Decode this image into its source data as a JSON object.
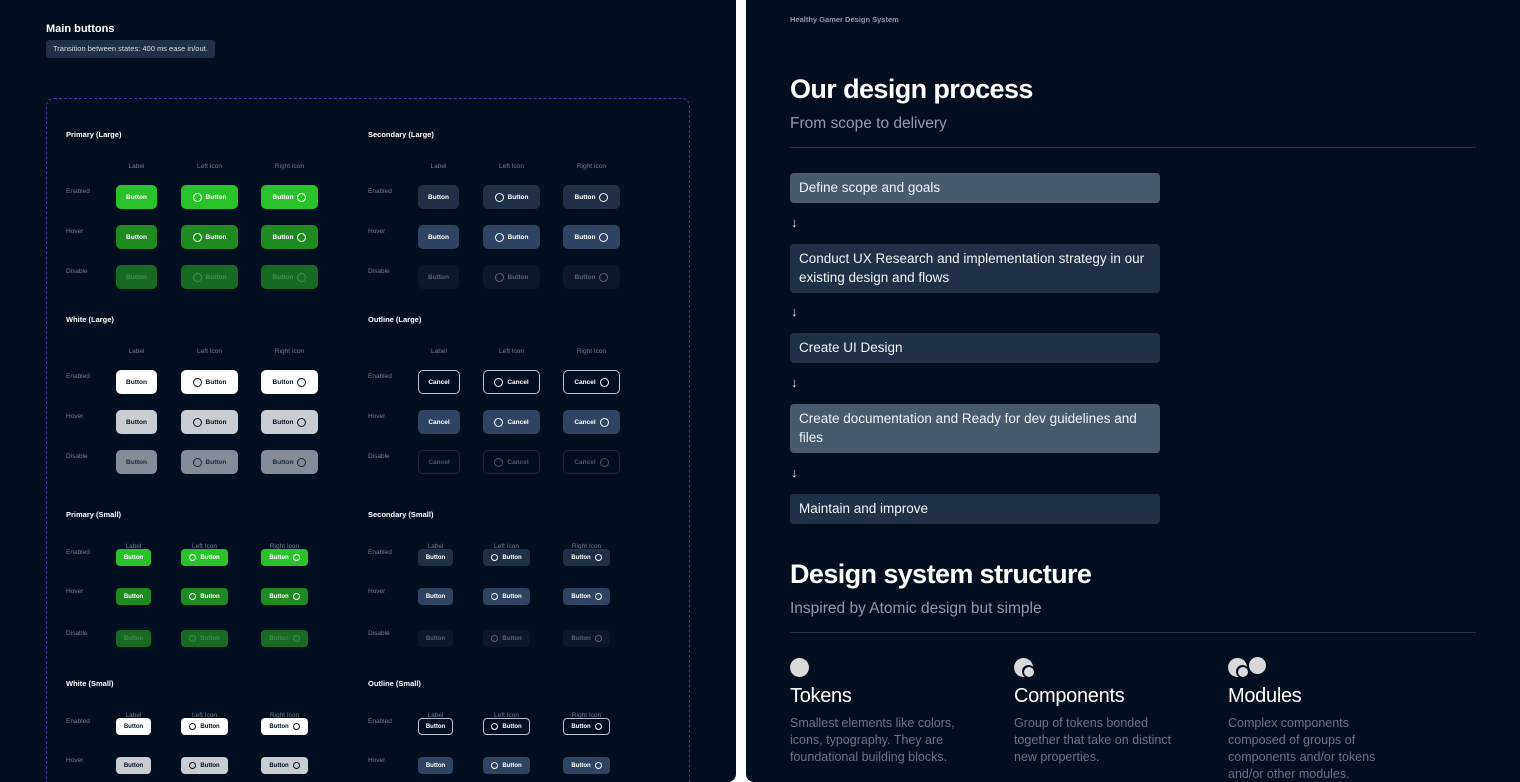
{
  "left": {
    "title": "Main buttons",
    "note": "Transition between states: 400 ms ease in/out.",
    "col_headers": [
      "Label",
      "Left Icon",
      "Right Icon"
    ],
    "row_labels": [
      "Enabled",
      "Hover",
      "Disable"
    ],
    "groups": [
      {
        "name": "primary-large",
        "title": "Primary (Large)",
        "variant": "primary",
        "size": "lg",
        "text": "Button"
      },
      {
        "name": "secondary-large",
        "title": "Secondary (Large)",
        "variant": "secondary",
        "size": "lg",
        "text": "Button"
      },
      {
        "name": "white-large",
        "title": "White (Large)",
        "variant": "white",
        "size": "lg",
        "text": "Button"
      },
      {
        "name": "outline-large",
        "title": "Outline (Large)",
        "variant": "outline",
        "size": "lg",
        "text": "Cancel"
      },
      {
        "name": "primary-small",
        "title": "Primary (Small)",
        "variant": "primary",
        "size": "sm",
        "text": "Button"
      },
      {
        "name": "secondary-small",
        "title": "Secondary (Small)",
        "variant": "secondary",
        "size": "sm",
        "text": "Button"
      },
      {
        "name": "white-small",
        "title": "White (Small)",
        "variant": "white",
        "size": "sm",
        "text": "Button"
      },
      {
        "name": "outline-small",
        "title": "Outline (Small)",
        "variant": "outline",
        "size": "sm",
        "text": "Button"
      }
    ]
  },
  "right": {
    "brand": "Healthy Gamer Design System",
    "process_title": "Our design process",
    "process_subtitle": "From scope to delivery",
    "steps": [
      {
        "text": "Define scope and goals",
        "highlight": true
      },
      {
        "text": "Conduct UX Research and implementation strategy in our existing design and flows",
        "highlight": false
      },
      {
        "text": "Create UI Design",
        "highlight": false
      },
      {
        "text": "Create documentation and Ready for dev guidelines and files",
        "highlight": true
      },
      {
        "text": "Maintain and improve",
        "highlight": false
      }
    ],
    "arrow": "↓",
    "structure_title": "Design system structure",
    "structure_subtitle": "Inspired by Atomic design but simple",
    "columns": [
      {
        "title": "Tokens",
        "desc": "Smallest elements like colors, icons, typography. They are foundational building blocks.",
        "icon": "single-circle-icon"
      },
      {
        "title": "Components",
        "desc": "Group of tokens bonded together that take on distinct new properties.",
        "icon": "bonded-circles-icon"
      },
      {
        "title": "Modules",
        "desc": "Complex components composed of groups of components and/or tokens and/or other modules.",
        "icon": "module-circles-icon"
      }
    ]
  },
  "colors": {
    "background": "#020f21",
    "primary_green": "#2ac22a",
    "secondary_navy": "#1f3048",
    "highlight_step": "#485a6e",
    "dashed_border": "#3b3aa8"
  }
}
